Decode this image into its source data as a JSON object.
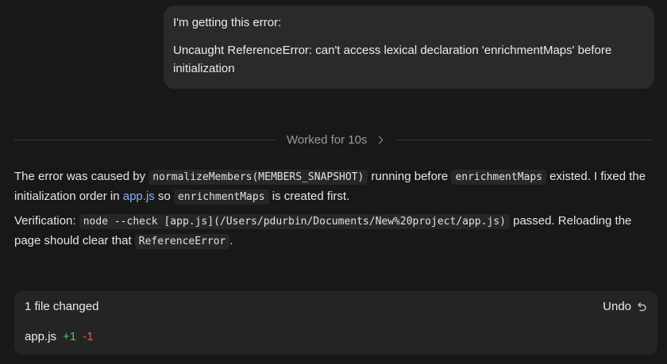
{
  "user_message": {
    "line1": "I'm getting this error:",
    "line2": "Uncaught ReferenceError: can't access lexical declaration 'enrichmentMaps' before initialization"
  },
  "worked": {
    "label": "Worked for 10s",
    "icon": "chevron-right-icon"
  },
  "response": {
    "p1": {
      "t1": "The error was caused by ",
      "code1": "normalizeMembers(MEMBERS_SNAPSHOT)",
      "t2": " running before ",
      "code2": "enrichmentMaps",
      "t3": " existed. I fixed the initialization order in ",
      "link": "app.js",
      "t4": " so ",
      "code3": "enrichmentMaps",
      "t5": " is created first."
    },
    "p2": {
      "t1": "Verification: ",
      "code1": "node --check [app.js](/Users/pdurbin/Documents/New%20project/app.js)",
      "t2": " passed. Reloading the page should clear that ",
      "code2": "ReferenceError",
      "t3": "."
    }
  },
  "changes": {
    "header": "1 file changed",
    "undo_label": "Undo",
    "undo_icon": "undo-icon",
    "files": [
      {
        "name": "app.js",
        "added": "+1",
        "removed": "-1"
      }
    ]
  },
  "colors": {
    "background": "#181818",
    "bubble": "#2a2a2a",
    "link": "#7fb4ff",
    "added": "#5cc26a",
    "removed": "#e0625e"
  }
}
